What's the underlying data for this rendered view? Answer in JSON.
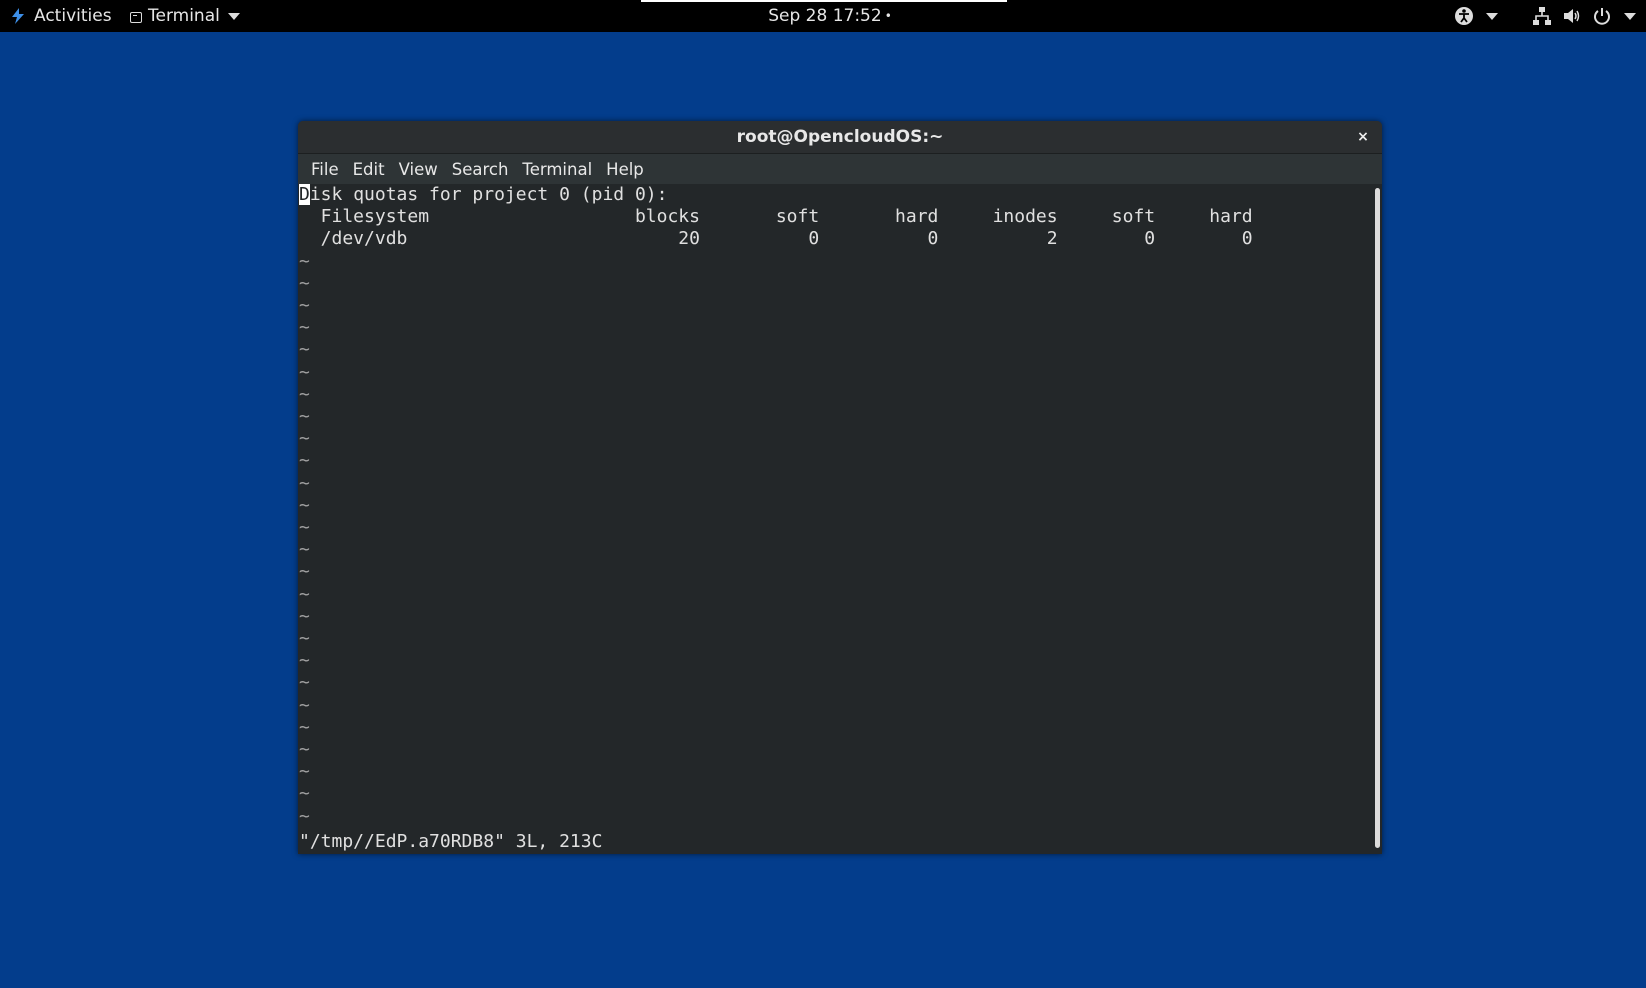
{
  "topbar": {
    "activities": "Activities",
    "app_menu": "Terminal",
    "clock": "Sep 28  17:52",
    "clock_dot": "•"
  },
  "window": {
    "title": "root@OpencloudOS:~",
    "close": "×",
    "menu": [
      "File",
      "Edit",
      "View",
      "Search",
      "Terminal",
      "Help"
    ]
  },
  "terminal": {
    "cursor_char": "D",
    "line1_rest": "isk quotas for project 0 (pid 0):",
    "header": "  Filesystem                   blocks       soft       hard     inodes     soft     hard",
    "row": "  /dev/vdb                         20          0          0          2        0        0",
    "tilde": "~",
    "status": "\"/tmp//EdP.a70RDB8\" 3L, 213C"
  },
  "colors": {
    "desktop": "#033d8c",
    "terminal_bg": "#232729",
    "titlebar": "#2b2e30"
  }
}
